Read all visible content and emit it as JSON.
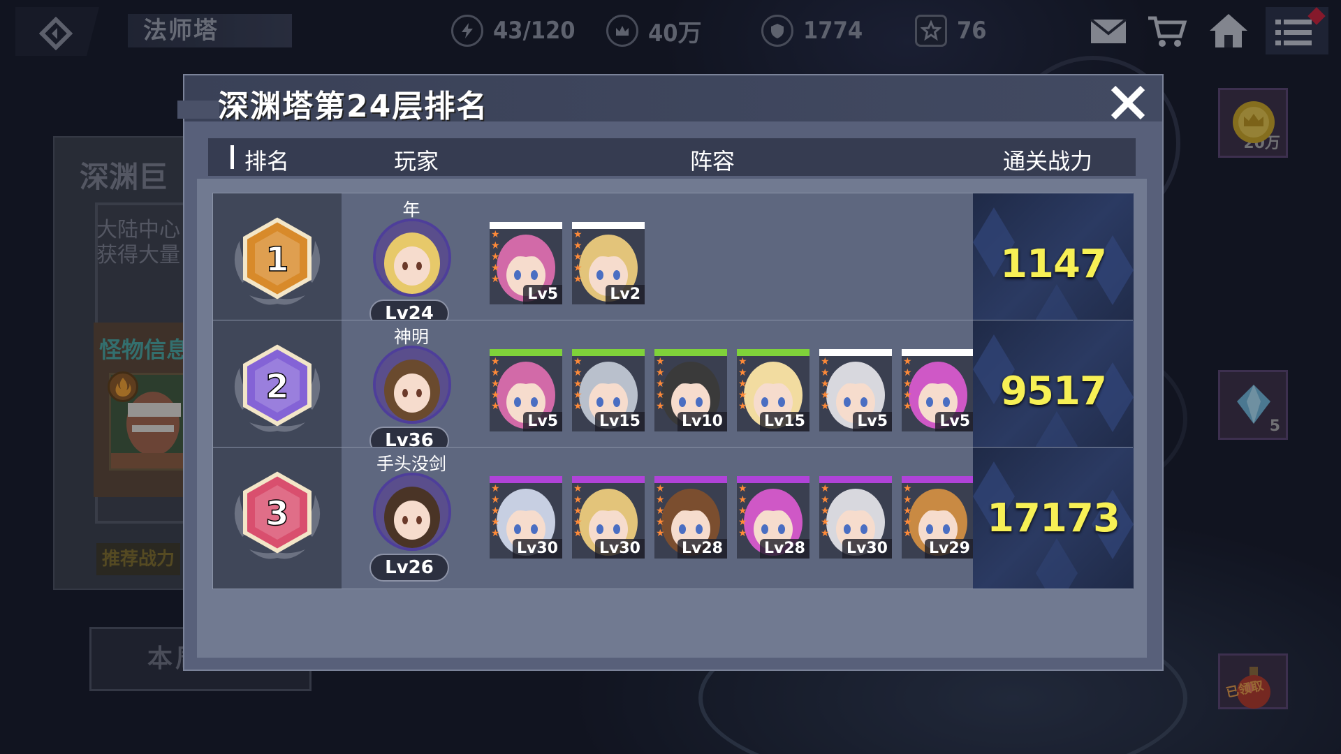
{
  "topbar": {
    "scene_title": "法师塔",
    "resources": [
      {
        "icon": "energy-icon",
        "value": "43/120"
      },
      {
        "icon": "gold-crown-icon",
        "value": "40万"
      },
      {
        "icon": "shield-badge-icon",
        "value": "1774"
      },
      {
        "icon": "star-icon",
        "value": "76"
      }
    ],
    "icons": [
      "mail-icon",
      "cart-icon",
      "home-icon",
      "menu-icon"
    ]
  },
  "background_panel": {
    "title": "深渊巨",
    "desc_line1": "大陆中心",
    "desc_line2": "获得大量",
    "monster_title": "怪物信息",
    "recommend_label": "推荐战力",
    "bottom_button": "本周排行"
  },
  "right_items": [
    {
      "icon": "gold-coin-icon",
      "count": "20万"
    },
    {
      "icon": "crystal-icon",
      "count": "5"
    },
    {
      "icon": "potion-icon",
      "count": "已领取"
    }
  ],
  "modal": {
    "title": "深渊塔第24层排名",
    "columns": {
      "rank": "排名",
      "player": "玩家",
      "team": "阵容",
      "power": "通关战力"
    },
    "rows": [
      {
        "rank": "1",
        "rank_color": "#d88a2a",
        "player_name": "年",
        "player_level": "Lv24",
        "power": "1147",
        "heroes": [
          {
            "level": "Lv5",
            "hair": "#d26aa8",
            "bar": "#ffffff"
          },
          {
            "level": "Lv2",
            "hair": "#e3c47a",
            "bar": "#ffffff"
          }
        ]
      },
      {
        "rank": "2",
        "rank_color": "#8463d6",
        "player_name": "神明",
        "player_level": "Lv36",
        "power": "9517",
        "heroes": [
          {
            "level": "Lv5",
            "hair": "#d26aa8",
            "bar": "#7fd23a"
          },
          {
            "level": "Lv15",
            "hair": "#b9c0cc",
            "bar": "#7fd23a"
          },
          {
            "level": "Lv10",
            "hair": "#3a3a3a",
            "bar": "#7fd23a"
          },
          {
            "level": "Lv15",
            "hair": "#f2dca0",
            "bar": "#7fd23a"
          },
          {
            "level": "Lv5",
            "hair": "#d8d8de",
            "bar": "#ffffff"
          },
          {
            "level": "Lv5",
            "hair": "#cf58c6",
            "bar": "#ffffff"
          }
        ]
      },
      {
        "rank": "3",
        "rank_color": "#d94f6e",
        "player_name": "手头没剑",
        "player_level": "Lv26",
        "power": "17173",
        "heroes": [
          {
            "level": "Lv30",
            "hair": "#c7cfe2",
            "bar": "#b043d8"
          },
          {
            "level": "Lv30",
            "hair": "#e3c47a",
            "bar": "#b043d8"
          },
          {
            "level": "Lv28",
            "hair": "#7b4e2f",
            "bar": "#b043d8"
          },
          {
            "level": "Lv28",
            "hair": "#cf58c6",
            "bar": "#b043d8"
          },
          {
            "level": "Lv30",
            "hair": "#d8d8de",
            "bar": "#b043d8"
          },
          {
            "level": "Lv29",
            "hair": "#c98a43",
            "bar": "#b043d8"
          }
        ]
      }
    ]
  }
}
